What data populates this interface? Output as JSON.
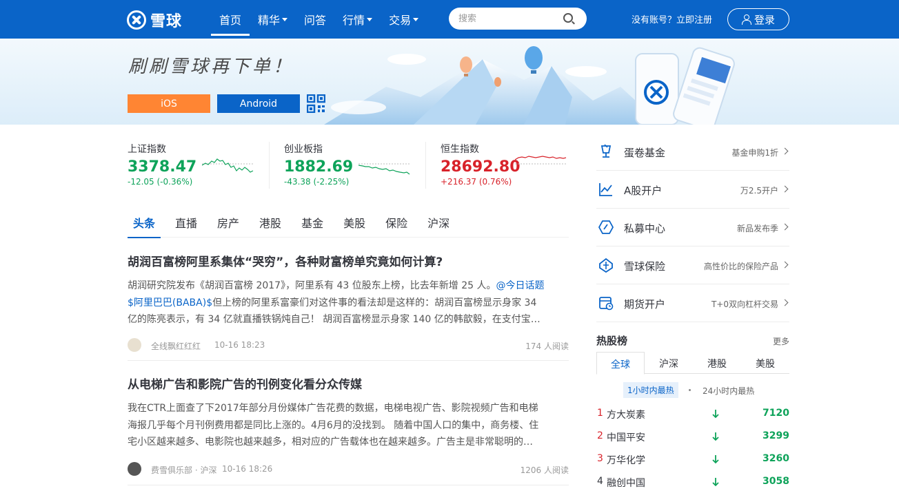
{
  "header": {
    "logo_text": "雪球",
    "nav": [
      {
        "label": "首页",
        "active": true,
        "dropdown": false
      },
      {
        "label": "精华",
        "active": false,
        "dropdown": true
      },
      {
        "label": "问答",
        "active": false,
        "dropdown": false
      },
      {
        "label": "行情",
        "active": false,
        "dropdown": true
      },
      {
        "label": "交易",
        "active": false,
        "dropdown": true
      }
    ],
    "search_placeholder": "搜索",
    "signup_text": "没有账号？立即注册",
    "login_label": "登录",
    "brand_color": "#0a64c8"
  },
  "banner": {
    "slogan": "刷刷雪球再下单！",
    "ios_label": "iOS",
    "android_label": "Android"
  },
  "indices": [
    {
      "name": "上证指数",
      "value": "3378.47",
      "change": "-12.05 (-0.36%)",
      "trend": "down"
    },
    {
      "name": "创业板指",
      "value": "1882.69",
      "change": "-43.38 (-2.25%)",
      "trend": "down"
    },
    {
      "name": "恒生指数",
      "value": "28692.80",
      "change": "+216.37 (0.76%)",
      "trend": "up"
    }
  ],
  "tabs": [
    "头条",
    "直播",
    "房产",
    "港股",
    "基金",
    "美股",
    "保险",
    "沪深"
  ],
  "articles": [
    {
      "title": "胡润百富榜阿里系集体“哭穷”，各种财富榜单究竟如何计算?",
      "body_lines": [
        {
          "text": "胡润研究院发布《胡润百富榜 2017》，阿里系有 43 位股东上榜，比去年新增 25 人。",
          "link": "@今日话题"
        },
        {
          "text": "但上榜的阿里系富豪们对这件事的看法却是这样的：胡润百富榜显示身家 34",
          "link": "$阿里巴巴(BABA)$",
          "link_first": true
        },
        {
          "text": "亿的陈亮表示，有 34 亿就直播铁锅炖自己！  胡润百富榜显示身家 140 亿的韩歆毅，在支付宝…",
          "link": ""
        }
      ],
      "author": "全线飘红红红",
      "time": "10-16 18:23",
      "reads": "174 人阅读"
    },
    {
      "title": "从电梯广告和影院广告的刊例变化看分众传媒",
      "body_lines": [
        {
          "text": "我在CTR上面查了下2017年部分月份媒体广告花费的数据，电梯电视广告、影院视频广告和电梯",
          "link": ""
        },
        {
          "text": "海报几乎每个月刊例费用都是同比上涨的。4月6月的没找到。 随着中国人口的集中，商务楼、住",
          "link": ""
        },
        {
          "text": "宅小区越来越多、电影院也越来越多，相对应的广告载体也在越来越多。广告主是非常聪明的…",
          "link": ""
        }
      ],
      "author": "费雪俱乐部 · 沪深",
      "time": "10-16 18:26",
      "reads": "1206 人阅读"
    }
  ],
  "services": [
    {
      "name": "蛋卷基金",
      "desc": "基金申购1折",
      "icon": "cup-icon"
    },
    {
      "name": "A股开户",
      "desc": "万2.5开户",
      "icon": "chart-icon"
    },
    {
      "name": "私募中心",
      "desc": "新品发布季",
      "icon": "diamond-icon"
    },
    {
      "name": "雪球保险",
      "desc": "高性价比的保险产品",
      "icon": "umbrella-icon"
    },
    {
      "name": "期货开户",
      "desc": "T+0双向杠杆交易",
      "icon": "futures-icon"
    }
  ],
  "hot_stocks": {
    "title": "热股榜",
    "more": "更多",
    "tabs": [
      "全球",
      "沪深",
      "港股",
      "美股"
    ],
    "active_tab": "全球",
    "sub_tabs": [
      "1小时内最热",
      "24小时内最热"
    ],
    "items": [
      {
        "rank": "1",
        "name": "方大炭素",
        "value": "7120",
        "trend": "down"
      },
      {
        "rank": "2",
        "name": "中国平安",
        "value": "3299",
        "trend": "down"
      },
      {
        "rank": "3",
        "name": "万华化学",
        "value": "3260",
        "trend": "down"
      },
      {
        "rank": "4",
        "name": "融创中国",
        "value": "3058",
        "trend": "down"
      }
    ]
  }
}
